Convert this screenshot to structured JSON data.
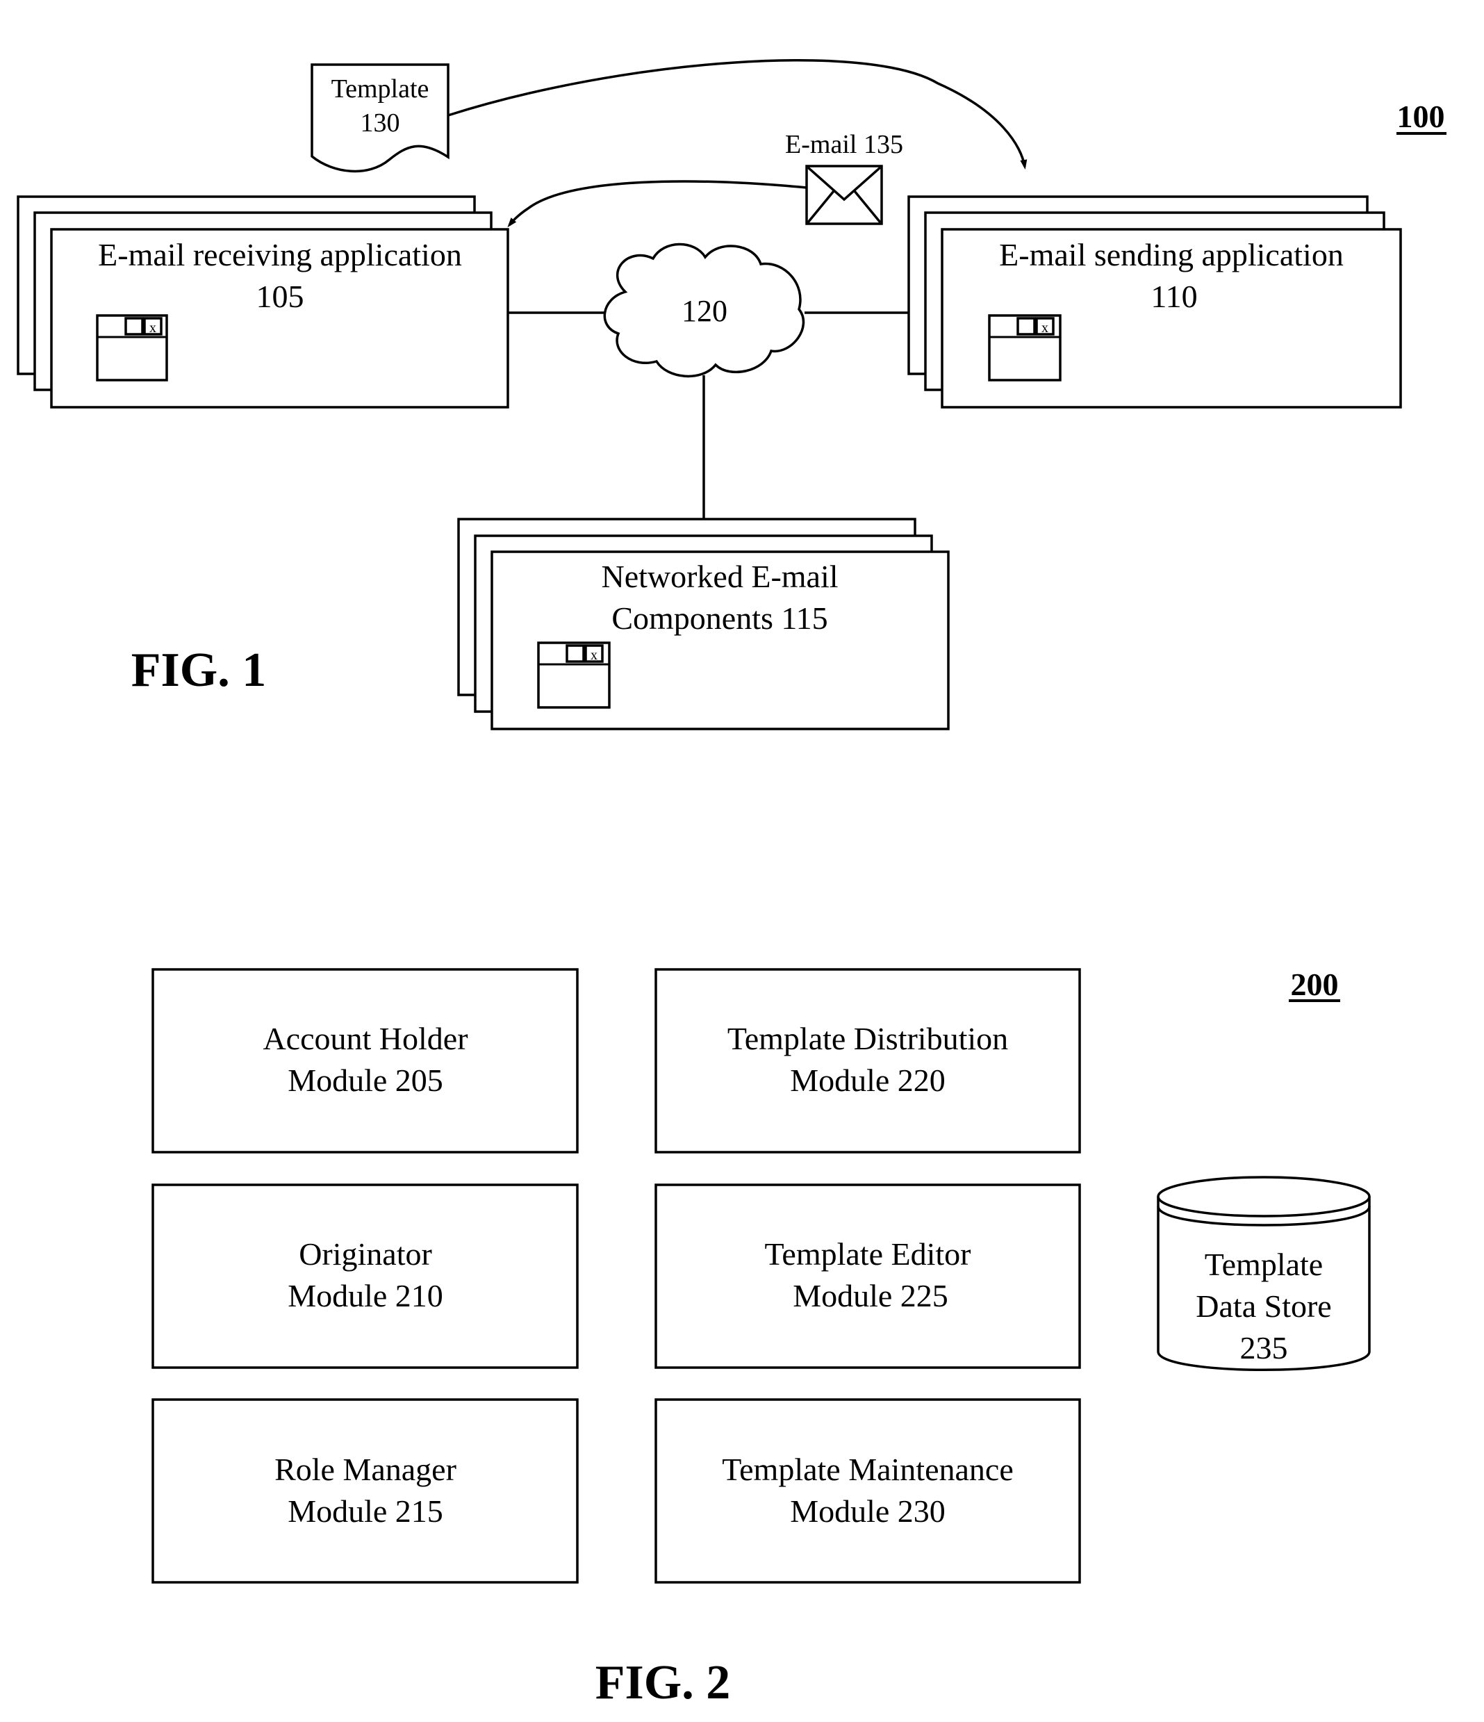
{
  "fig1": {
    "reference": "100",
    "caption": "FIG. 1",
    "template": {
      "line1": "Template",
      "line2": "130"
    },
    "email": {
      "label": "E-mail 135"
    },
    "network": {
      "label": "120"
    },
    "receiving_app": {
      "line1": "E-mail receiving application",
      "line2": "105"
    },
    "sending_app": {
      "line1": "E-mail sending application",
      "line2": "110"
    },
    "components": {
      "line1": "Networked E-mail",
      "line2": "Components 115"
    },
    "window_icon": {
      "minimize": "_",
      "close": "x"
    }
  },
  "fig2": {
    "reference": "200",
    "caption": "FIG. 2",
    "modules": [
      {
        "line1": "Account Holder",
        "line2": "Module 205"
      },
      {
        "line1": "Originator",
        "line2": "Module 210"
      },
      {
        "line1": "Role Manager",
        "line2": "Module 215"
      },
      {
        "line1": "Template Distribution",
        "line2": "Module 220"
      },
      {
        "line1": "Template Editor",
        "line2": "Module 225"
      },
      {
        "line1": "Template Maintenance",
        "line2": "Module 230"
      }
    ],
    "data_store": {
      "line1": "Template",
      "line2": "Data Store",
      "line3": "235"
    }
  }
}
